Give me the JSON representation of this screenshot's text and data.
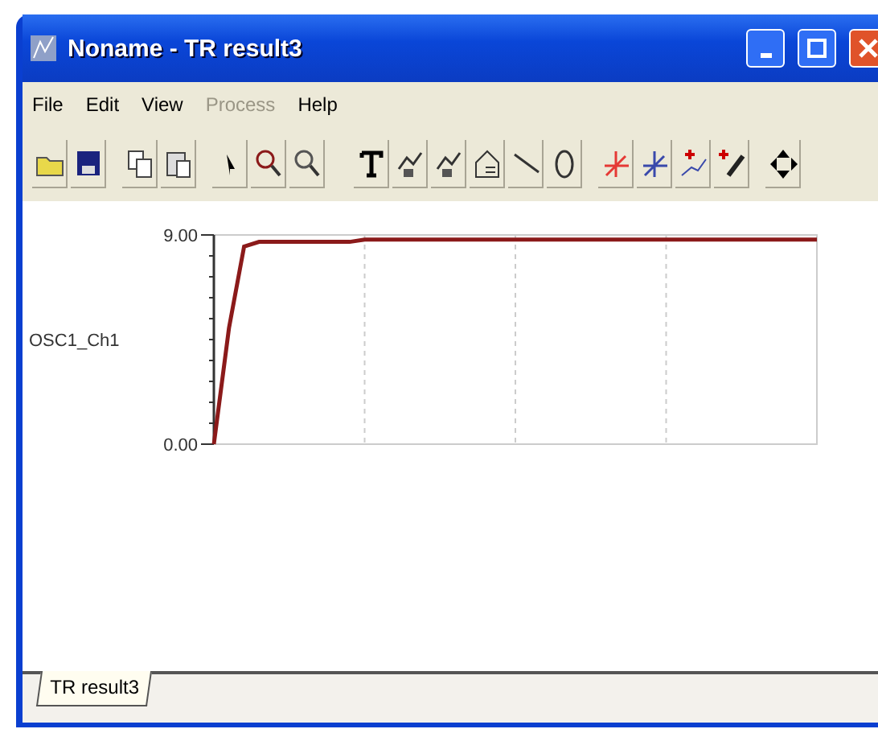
{
  "window": {
    "title": "Noname - TR result3"
  },
  "menu": [
    {
      "label": "File",
      "disabled": false
    },
    {
      "label": "Edit",
      "disabled": false
    },
    {
      "label": "View",
      "disabled": false
    },
    {
      "label": "Process",
      "disabled": true
    },
    {
      "label": "Help",
      "disabled": false
    }
  ],
  "plot": {
    "chart_data": {
      "type": "line",
      "grid": true,
      "categories": [
        null,
        null,
        null,
        null,
        null,
        null,
        null,
        null,
        null,
        null,
        null,
        null,
        null,
        null,
        null,
        null,
        null,
        null,
        null,
        null,
        null,
        null,
        null,
        null,
        null,
        null,
        null,
        null,
        null,
        null,
        null,
        null,
        null,
        null,
        null,
        null,
        null,
        null,
        null,
        null,
        null
      ],
      "ylim": [
        0,
        9
      ],
      "yticks": [
        {
          "value": 0,
          "label": "0.00"
        },
        {
          "value": 9,
          "label": "9.00"
        }
      ],
      "series": [
        {
          "name": "OSC1_Ch1",
          "color": "#8b1a1a",
          "values": [
            0,
            5,
            8.5,
            8.7,
            8.7,
            8.7,
            8.7,
            8.7,
            8.7,
            8.7,
            8.8,
            8.8,
            8.8,
            8.8,
            8.8,
            8.8,
            8.8,
            8.8,
            8.8,
            8.8,
            8.8,
            8.8,
            8.8,
            8.8,
            8.8,
            8.8,
            8.8,
            8.8,
            8.8,
            8.8,
            8.8,
            8.8,
            8.8,
            8.8,
            8.8,
            8.8,
            8.8,
            8.8,
            8.8,
            8.8,
            8.8
          ]
        }
      ]
    }
  },
  "tabs": [
    {
      "label": "TR result3",
      "selected": true
    }
  ]
}
